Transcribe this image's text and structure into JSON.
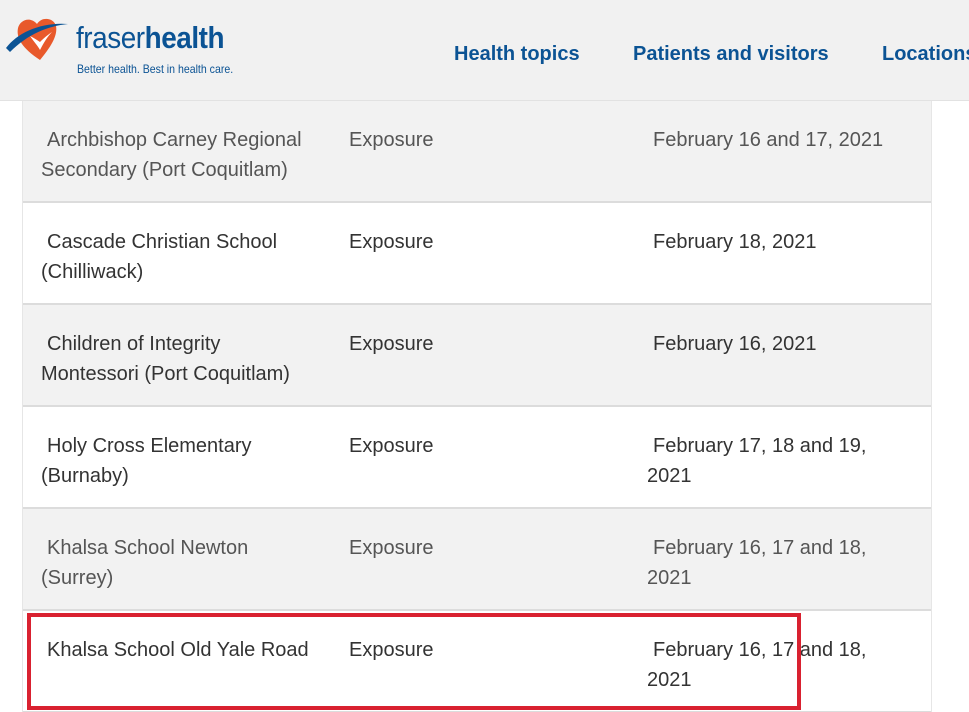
{
  "header": {
    "logo": {
      "word_part1": "fraser",
      "word_part2": "health",
      "tagline": "Better health. Best in health care."
    },
    "nav": [
      {
        "label": "Health topics"
      },
      {
        "label": "Patients and visitors"
      },
      {
        "label": "Locations"
      }
    ]
  },
  "table": {
    "rows": [
      {
        "school": "Archbishop Carney Regional Secondary (Port Coquitlam)",
        "type": "Exposure",
        "date": "February 16 and 17, 2021"
      },
      {
        "school": "Cascade Christian School (Chilliwack)",
        "type": "Exposure",
        "date": "February 18, 2021"
      },
      {
        "school": "Children of Integrity Montessori (Port Coquitlam)",
        "type": "Exposure",
        "date": "February 16, 2021"
      },
      {
        "school": "Holy Cross Elementary (Burnaby)",
        "type": "Exposure",
        "date": "February 17, 18 and 19, 2021"
      },
      {
        "school": "Khalsa School Newton (Surrey)",
        "type": "Exposure",
        "date": "February 16, 17 and 18, 2021"
      },
      {
        "school": "Khalsa School Old Yale Road",
        "type": "Exposure",
        "date": "February 16, 17 and 18, 2021"
      }
    ]
  },
  "colors": {
    "brand_blue": "#0b5394",
    "brand_orange": "#e8592b",
    "highlight_red": "#d92130",
    "header_bg": "#f1f1f1",
    "row_shade": "#f2f2f2"
  },
  "icons": {
    "logo_mark": "heart-swoosh-icon"
  }
}
